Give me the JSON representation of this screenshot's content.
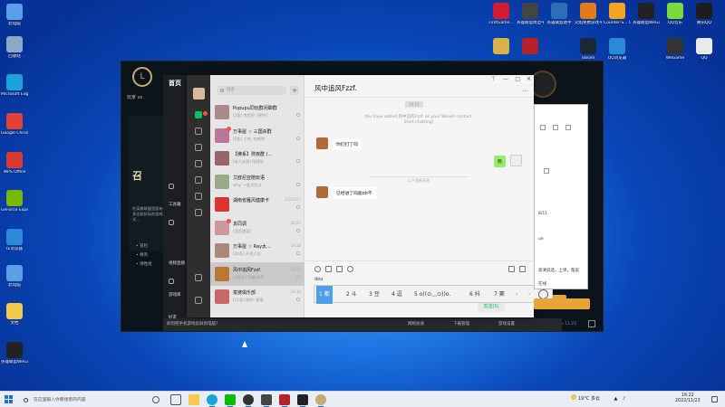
{
  "desktop_left": [
    {
      "label": "此电脑",
      "color": "#5aa0e6",
      "icon": "computer-icon"
    },
    {
      "label": "回收站",
      "color": "#8aa8c8",
      "icon": "recycle-bin-icon"
    },
    {
      "label": "Microsoft Edge",
      "color": "#1aa2d9",
      "icon": "edge-icon"
    },
    {
      "label": "Google Chrome",
      "color": "#e34133",
      "icon": "chrome-icon"
    },
    {
      "label": "WPS Office",
      "color": "#d93a32",
      "icon": "wps-icon"
    },
    {
      "label": "GeForce Experience",
      "color": "#76b900",
      "icon": "nvidia-icon"
    },
    {
      "label": "IE浏览器",
      "color": "#2a8ad8",
      "icon": "ie-icon"
    },
    {
      "label": "此电脑",
      "color": "#5aa0e6",
      "icon": "computer-icon"
    },
    {
      "label": "文档",
      "color": "#f3c94e",
      "icon": "folder-icon"
    },
    {
      "label": "英雄联盟WeGame版",
      "color": "#222",
      "icon": "lol-icon"
    }
  ],
  "desktop_right": [
    {
      "label": "FirstGame...",
      "color": "#d11d2f",
      "icon": "app-icon"
    },
    {
      "label": "英雄联盟周边平台",
      "color": "#444",
      "icon": "app-icon"
    },
    {
      "label": "英雄联盟助手",
      "color": "#2c6fb8",
      "icon": "app-icon"
    },
    {
      "label": "火焰免费游戏平台",
      "color": "#e37b1a",
      "icon": "app-icon"
    },
    {
      "label": "Counter-S... Global Off...",
      "color": "#f3a521",
      "icon": "csgo-icon"
    },
    {
      "label": "英雄联盟WeGame版",
      "color": "#222",
      "icon": "lol-icon"
    },
    {
      "label": "QQ音乐",
      "color": "#7bd93b",
      "icon": "qqmusic-icon"
    },
    {
      "label": "腾讯QQ",
      "color": "#1d1d1d",
      "icon": "qq-icon"
    },
    {
      "label": "",
      "color": "#d9b04a",
      "icon": "app-icon"
    },
    {
      "label": "",
      "color": "#b3232a",
      "icon": "app-icon"
    },
    {
      "label": "Steam",
      "color": "#1b2838",
      "icon": "steam-icon"
    },
    {
      "label": "QQ浏览器",
      "color": "#2a8ad8",
      "icon": "qqbrowser-icon"
    },
    {
      "label": "WeGame",
      "color": "#333",
      "icon": "wegame-icon"
    },
    {
      "label": "QQ",
      "color": "#eaeaea",
      "icon": "qq-icon"
    }
  ],
  "lol": {
    "tab": "玩家 vs",
    "big": "召",
    "news": "在英雄联盟里面有很多比较好玩的游戏模式...",
    "opt1": "• 冒险",
    "opt2": "• 精英",
    "opt3": "• 弹性组",
    "ver": "v 11.23"
  },
  "qq": {
    "logo": "首页",
    "side1": "工具箱",
    "side2": "视频直播",
    "side3": "游戏库",
    "side4": "好友",
    "bottom_tip": "如何把手机游戏投屏到电脑?",
    "bottom_r1": "网络加速",
    "bottom_r2": "下载管理",
    "bottom_r3": "游戏设置"
  },
  "wechat": {
    "search_placeholder": "搜索",
    "plus": "+",
    "chats": [
      {
        "name": "Pupupu同玩群闲聊群",
        "preview": "[2条] 李世民: [图片]",
        "time": "",
        "color": "#a88"
      },
      {
        "name": "万事屋 ☆ 三国杀群",
        "preview": "[5条] 小杰: 哈哈哈",
        "time": "",
        "color": "#b79"
      },
      {
        "name": "【佛系】熬夜群 (...",
        "preview": "[有人@我] 陪我玩",
        "time": "",
        "color": "#966"
      },
      {
        "name": "艾欧尼亚陪玩语",
        "preview": "why: 一起大乱斗",
        "time": "",
        "color": "#9a8"
      },
      {
        "name": "湖南省雁风健康卡",
        "preview": "",
        "time": "21/10/27",
        "color": "#d33"
      },
      {
        "name": "袁同调",
        "preview": "[语音通话]",
        "time": "16:22",
        "color": "#c99"
      },
      {
        "name": "万事屋 ☆ Ray太...",
        "preview": "[20条] 开发人员",
        "time": "16:18",
        "color": "#a87"
      },
      {
        "name": "风中追风Fzzf.",
        "preview": "已经进了吗能ob不",
        "time": "16:20",
        "color": "#b73"
      },
      {
        "name": "富婆俱乐部",
        "preview": "[11条] 郭明: 表情",
        "time": "16:16",
        "color": "#c66"
      }
    ],
    "title": "风中追风Fzzf.",
    "more": "···",
    "stamp": "16:11",
    "system_msg": "You have added 风中追风Fzzf. as your Weixin contact. Start chatting!",
    "msg1": "你们打了吗",
    "msg2": "嗯",
    "divider": "以下是新消息",
    "msg3": "已经进了吗能ob不",
    "input": "dou",
    "send": "发送(S)"
  },
  "ime": {
    "c1": "1 都",
    "c2": "2 斗",
    "c3": "3 豆",
    "c4": "4 逗",
    "c5": "5 o((⊙﹏⊙))o.",
    "c6": "6 抖",
    "c7": "7 窦"
  },
  "browser": {
    "date": "8/11",
    "r1": "ue",
    "r2": "高清说话，上单，帮说",
    "r3": "在线"
  },
  "taskbar": {
    "search": "在这里输入你要搜索的内容",
    "weather": "19°C 多云",
    "time": "16:22",
    "date": "2022/11/23"
  }
}
